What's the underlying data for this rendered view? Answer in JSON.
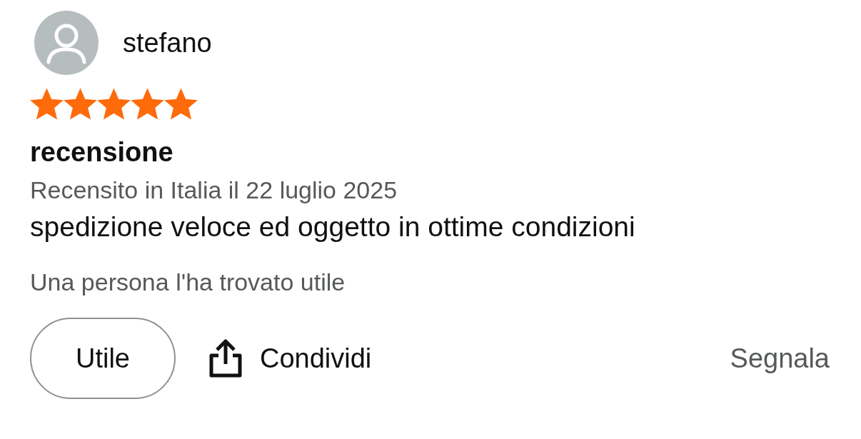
{
  "review": {
    "author": "stefano",
    "stars": 5,
    "title": "recensione",
    "meta": "Recensito in Italia il 22 luglio 2025",
    "body": "spedizione veloce ed oggetto in ottime condizioni",
    "helpful_count": "Una persona l'ha trovato utile"
  },
  "actions": [
    {
      "kind": "pill",
      "label": "Utile"
    },
    {
      "kind": "share",
      "label": "Condividi"
    },
    {
      "kind": "link",
      "label": "Segnala"
    }
  ]
}
